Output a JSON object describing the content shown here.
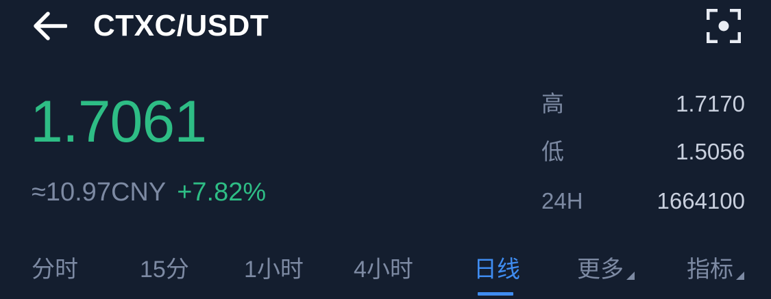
{
  "header": {
    "title": "CTXC/USDT"
  },
  "ticker": {
    "price": "1.7061",
    "cny_price": "≈10.97CNY",
    "change_percent": "+7.82%"
  },
  "stats": {
    "high": {
      "label": "高",
      "value": "1.7170"
    },
    "low": {
      "label": "低",
      "value": "1.5056"
    },
    "volume_24h": {
      "label": "24H",
      "value": "1664100"
    }
  },
  "tabs": [
    {
      "label": "分时",
      "active": false
    },
    {
      "label": "15分",
      "active": false
    },
    {
      "label": "1小时",
      "active": false
    },
    {
      "label": "4小时",
      "active": false
    },
    {
      "label": "日线",
      "active": true
    },
    {
      "label": "更多",
      "active": false,
      "dropdown": true
    },
    {
      "label": "指标",
      "active": false,
      "dropdown": true
    }
  ],
  "icons": {
    "back": "arrow-left-icon",
    "scan": "scan-frame-icon"
  },
  "colors": {
    "background": "#141e2f",
    "up_green": "#2ebd85",
    "accent_blue": "#3f8cf0",
    "muted_text": "#7d8aa3"
  }
}
